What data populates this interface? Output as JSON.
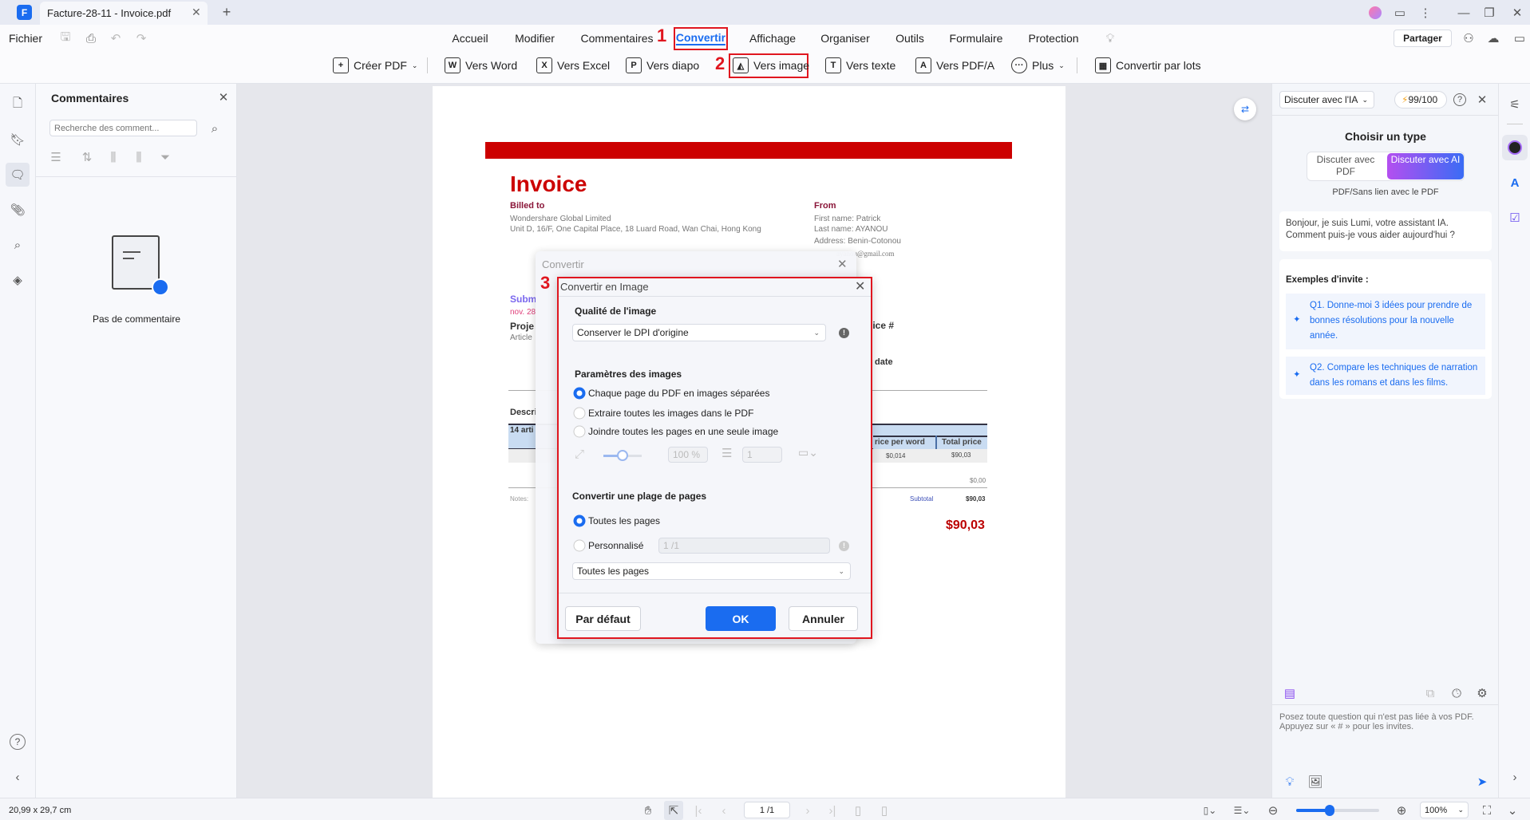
{
  "titlebar": {
    "tab_title": "Facture-28-11 - Invoice.pdf"
  },
  "menu": {
    "file": "Fichier",
    "tabs": [
      "Accueil",
      "Modifier",
      "Commentaires",
      "Convertir",
      "Affichage",
      "Organiser",
      "Outils",
      "Formulaire",
      "Protection"
    ],
    "active_tab": "Convertir",
    "share": "Partager"
  },
  "toolbar": {
    "create_pdf": "Créer PDF",
    "to_word": "Vers Word",
    "to_excel": "Vers Excel",
    "to_slides": "Vers diapo",
    "to_image": "Vers image",
    "to_text": "Vers texte",
    "to_pdfa": "Vers PDF/A",
    "more": "Plus",
    "batch": "Convertir par lots"
  },
  "annotations": {
    "step1": "1",
    "step2": "2",
    "step3": "3"
  },
  "accent_red": "#e0161f",
  "accent_blue": "#1a6cf0",
  "comments": {
    "title": "Commentaires",
    "search_placeholder": "Recherche des comment...",
    "empty": "Pas de commentaire"
  },
  "invoice": {
    "title": "Invoice",
    "billed_to": "Billed to",
    "billed_name": "Wondershare Global Limited",
    "billed_address": "Unit D, 16/F, One Capital Place, 18 Luard Road, Wan Chai, Hong Kong",
    "from": "From",
    "first_name": "First name: Patrick",
    "last_name": "Last name: AYANOU",
    "address": "Address: Benin-Cotonou",
    "email": "ayanou@gmail.com",
    "submitted": "Subm",
    "date": "nov. 28",
    "project": "Proje",
    "article": "Article",
    "invoice_no": "oice #",
    "due_date": "date",
    "description": "Descri",
    "items": "14 arti",
    "col_price_word": "rice per word",
    "col_total": "Total price",
    "price_word": "$0,014",
    "row_total": "$90,03",
    "zero": "$0,00",
    "notes": "Notes:",
    "subtotal_label": "Subtotal",
    "subtotal": "$90,03",
    "total": "$90,03"
  },
  "convert_dialog": {
    "title": "Convertir"
  },
  "image_dialog": {
    "title": "Convertir en Image",
    "quality_label": "Qualité de l'image",
    "quality_value": "Conserver le DPI d'origine",
    "params_label": "Paramètres des images",
    "options": [
      "Chaque page du PDF en images séparées",
      "Extraire toutes les images dans le PDF",
      "Joindre toutes les pages en une seule image"
    ],
    "selected_option": 0,
    "scale_value": "100 %",
    "scale_slider": 0.5,
    "count_value": "1",
    "range_label": "Convertir une plage de pages",
    "all_pages": "Toutes les pages",
    "custom": "Personnalisé",
    "custom_value": "1 /1",
    "range_select": "Toutes les pages",
    "default_btn": "Par défaut",
    "ok_btn": "OK",
    "cancel_btn": "Annuler"
  },
  "ai": {
    "mode": "Discuter avec l'IA",
    "credits": "99/100",
    "choose": "Choisir un type",
    "seg_pdf": "Discuter avec PDF",
    "seg_ai": "Discuter avec AI",
    "subtitle": "PDF/Sans lien avec le PDF",
    "greeting": "Bonjour, je suis Lumi, votre assistant IA. Comment puis-je vous aider aujourd'hui ?",
    "examples_title": "Exemples d'invite :",
    "q1": "Q1. Donne-moi 3 idées pour prendre de bonnes résolutions pour la nouvelle année.",
    "q2": "Q2. Compare les techniques de narration dans les romans et dans les films.",
    "placeholder": "Posez toute question qui n'est pas liée à vos PDF. Appuyez sur « # » pour les invites."
  },
  "status": {
    "dimensions": "20,99 x 29,7 cm",
    "page": "1 /1",
    "zoom": "100%",
    "zoom_slider": 0.4
  }
}
